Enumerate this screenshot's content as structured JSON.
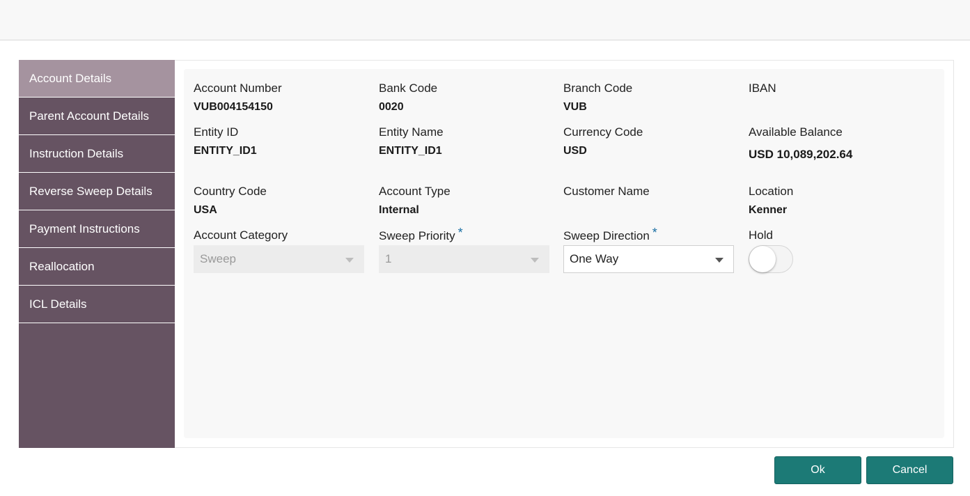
{
  "sidebar": {
    "items": [
      {
        "label": "Account Details",
        "active": true
      },
      {
        "label": "Parent Account Details"
      },
      {
        "label": "Instruction Details"
      },
      {
        "label": "Reverse Sweep Details"
      },
      {
        "label": "Payment Instructions"
      },
      {
        "label": "Reallocation"
      },
      {
        "label": "ICL Details"
      }
    ]
  },
  "fields": {
    "account_number": {
      "label": "Account Number",
      "value": "VUB004154150"
    },
    "bank_code": {
      "label": "Bank Code",
      "value": "0020"
    },
    "branch_code": {
      "label": "Branch Code",
      "value": "VUB"
    },
    "iban": {
      "label": "IBAN",
      "value": ""
    },
    "entity_id": {
      "label": "Entity ID",
      "value": "ENTITY_ID1"
    },
    "entity_name": {
      "label": "Entity Name",
      "value": "ENTITY_ID1"
    },
    "currency_code": {
      "label": "Currency Code",
      "value": "USD"
    },
    "available_balance": {
      "label": "Available Balance",
      "value": "USD 10,089,202.64"
    },
    "country_code": {
      "label": "Country Code",
      "value": "USA"
    },
    "account_type": {
      "label": "Account Type",
      "value": "Internal"
    },
    "customer_name": {
      "label": "Customer Name",
      "value": ""
    },
    "location": {
      "label": "Location",
      "value": "Kenner"
    },
    "account_category": {
      "label": "Account Category",
      "value": "Sweep"
    },
    "sweep_priority": {
      "label": "Sweep Priority",
      "value": "1",
      "required": "*"
    },
    "sweep_direction": {
      "label": "Sweep Direction",
      "value": "One Way",
      "required": "*"
    },
    "hold": {
      "label": "Hold",
      "on": false
    }
  },
  "buttons": {
    "ok": "Ok",
    "cancel": "Cancel"
  },
  "colors": {
    "sidebar": "#665362",
    "sidebar_active": "#a5939f",
    "button": "#1c7a76",
    "required": "#1a6fa3"
  }
}
